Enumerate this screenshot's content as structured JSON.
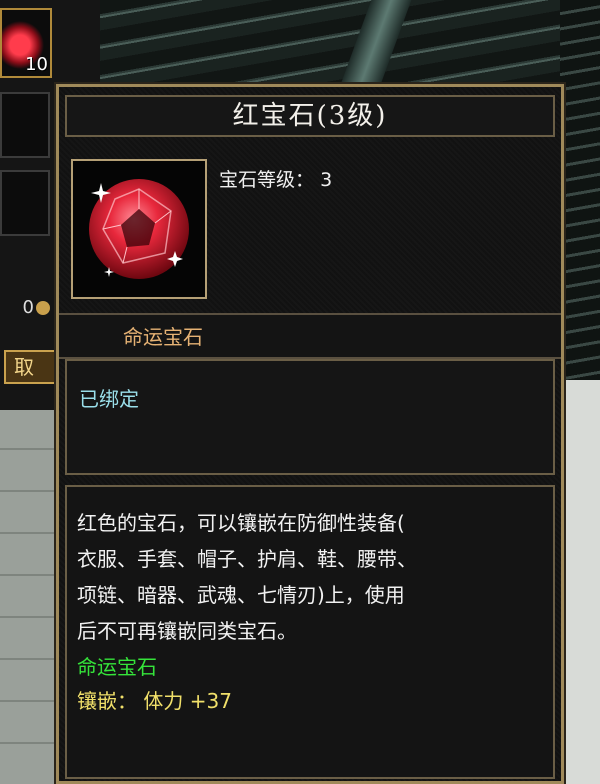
{
  "inventory": {
    "gem_slot_count": "10",
    "gold_amount": "0",
    "take_button_label": "取"
  },
  "tooltip": {
    "title": "红宝石(3级)",
    "level_label": "宝石等级：",
    "level_value": "3",
    "category": "命运宝石",
    "bind_status": "已绑定",
    "description_lines": [
      "红色的宝石，可以镶嵌在防御性装备(",
      "衣服、手套、帽子、护肩、鞋、腰带、",
      "项链、暗器、武魂、七情刃)上，使用",
      "后不可再镶嵌同类宝石。"
    ],
    "set_name": "命运宝石",
    "inlay_label": "镶嵌：",
    "inlay_stat": "体力",
    "inlay_bonus": "+37"
  },
  "colors": {
    "frame_gold": "#a08a5a",
    "category_orange": "#e6b274",
    "bound_cyan": "#9adfea",
    "set_green": "#35e43a",
    "inlay_yellow": "#f1e06a"
  },
  "icons": {
    "item_icon": "red-gem-icon",
    "coin": "gold-coin-icon"
  }
}
